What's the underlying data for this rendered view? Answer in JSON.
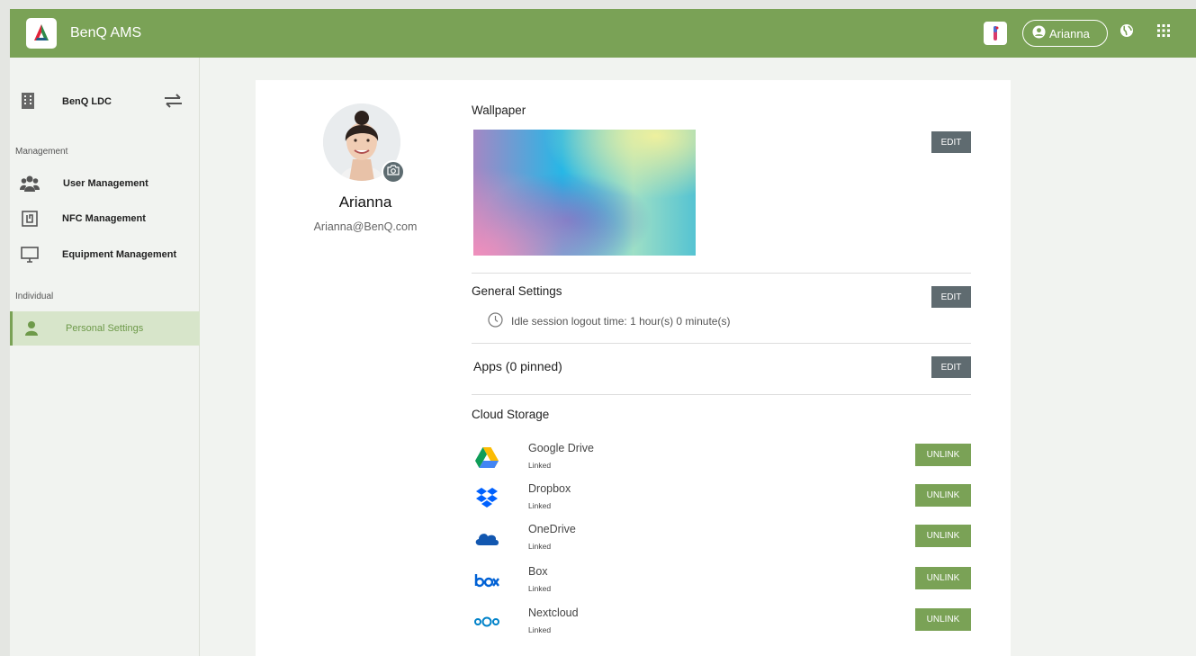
{
  "header": {
    "app_title": "BenQ AMS",
    "user_name": "Arianna",
    "brand_color": "#7aa256"
  },
  "sidebar": {
    "org_name": "BenQ LDC",
    "management_label": "Management",
    "individual_label": "Individual",
    "management_items": [
      {
        "label": "User Management",
        "icon": "users-icon"
      },
      {
        "label": "NFC Management",
        "icon": "nfc-icon"
      },
      {
        "label": "Equipment Management",
        "icon": "monitor-icon"
      }
    ],
    "individual_items": [
      {
        "label": "Personal Settings",
        "icon": "person-icon",
        "active": true
      }
    ]
  },
  "profile": {
    "name": "Arianna",
    "email": "Arianna@BenQ.com"
  },
  "wallpaper": {
    "title": "Wallpaper",
    "edit_label": "EDIT"
  },
  "general": {
    "title": "General Settings",
    "edit_label": "EDIT",
    "idle_text": "Idle session logout time: 1 hour(s) 0 minute(s)"
  },
  "apps": {
    "title": "Apps (0 pinned)",
    "edit_label": "EDIT"
  },
  "cloud": {
    "title": "Cloud Storage",
    "items": [
      {
        "name": "Google Drive",
        "status": "Linked",
        "button": "UNLINK",
        "icon": "google-drive-icon"
      },
      {
        "name": "Dropbox",
        "status": "Linked",
        "button": "UNLINK",
        "icon": "dropbox-icon"
      },
      {
        "name": "OneDrive",
        "status": "Linked",
        "button": "UNLINK",
        "icon": "onedrive-icon"
      },
      {
        "name": "Box",
        "status": "Linked",
        "button": "UNLINK",
        "icon": "box-icon"
      },
      {
        "name": "Nextcloud",
        "status": "Linked",
        "button": "UNLINK",
        "icon": "nextcloud-icon"
      }
    ]
  }
}
